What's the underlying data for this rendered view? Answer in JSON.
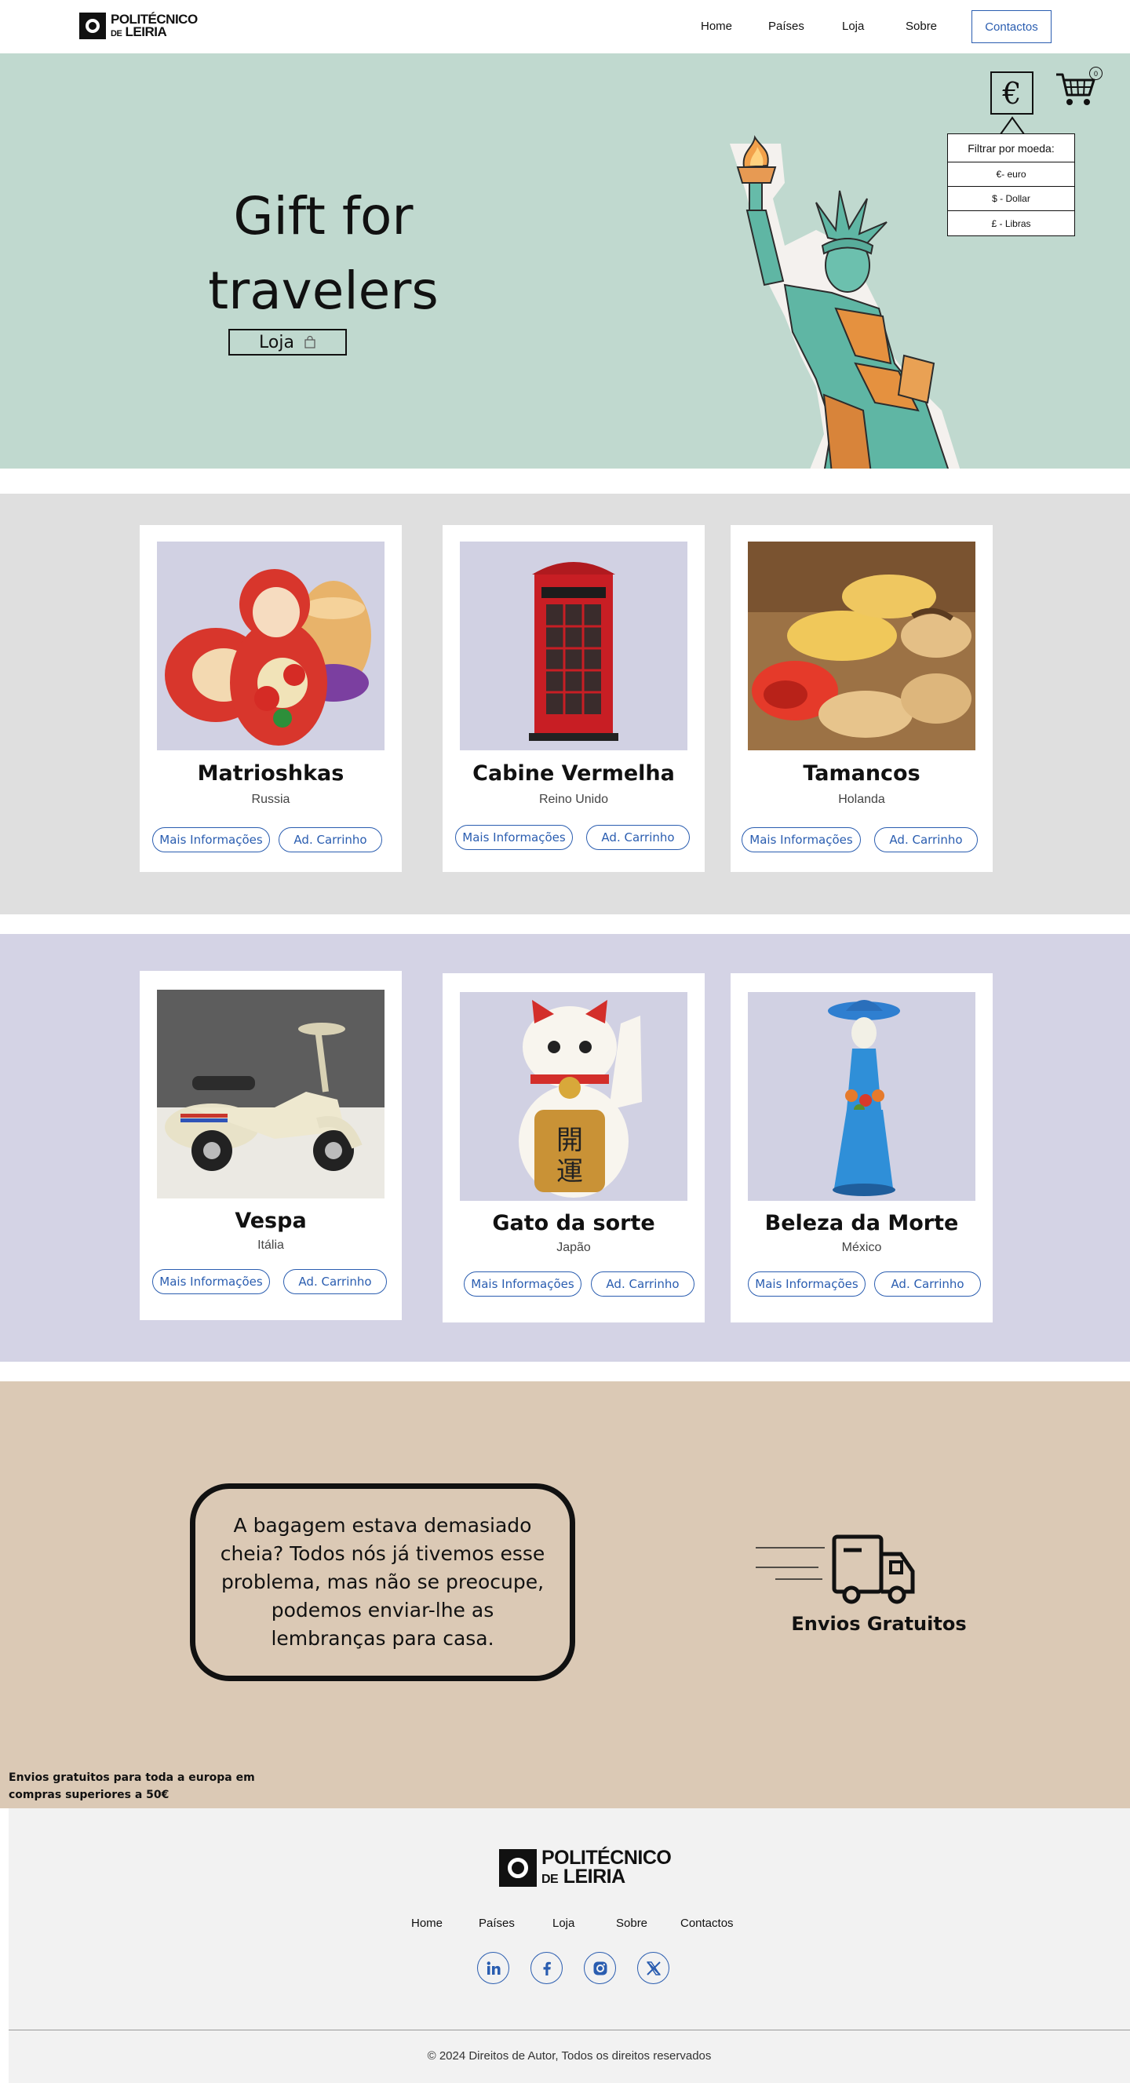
{
  "header": {
    "logo": {
      "line1": "POLITÉCNICO",
      "line2_small": "DE",
      "line2": "LEIRIA"
    },
    "nav": [
      "Home",
      "Países",
      "Loja",
      "Sobre"
    ],
    "contact_label": "Contactos"
  },
  "hero": {
    "title_line1": "Gift for",
    "title_line2": "travelers",
    "button_label": "Loja",
    "currency_symbol": "€",
    "cart_count": "0",
    "filter": {
      "title": "Filtrar por moeda:",
      "options": [
        "€- euro",
        "$ - Dollar",
        "£ - Libras"
      ]
    },
    "background_color": "#c0d9cf"
  },
  "products_row1": [
    {
      "name": "Matrioshkas",
      "country": "Russia",
      "info_label": "Mais Informações",
      "cart_label": "Ad. Carrinho"
    },
    {
      "name": "Cabine Vermelha",
      "country": "Reino Unido",
      "info_label": "Mais Informações",
      "cart_label": "Ad. Carrinho"
    },
    {
      "name": "Tamancos",
      "country": "Holanda",
      "info_label": "Mais Informações",
      "cart_label": "Ad. Carrinho"
    }
  ],
  "products_row2": [
    {
      "name": "Vespa",
      "country": "Itália",
      "info_label": "Mais Informações",
      "cart_label": "Ad. Carrinho"
    },
    {
      "name": "Gato da sorte",
      "country": "Japão",
      "info_label": "Mais Informações",
      "cart_label": "Ad. Carrinho"
    },
    {
      "name": "Beleza da Morte",
      "country": "México",
      "info_label": "Mais Informações",
      "cart_label": "Ad. Carrinho"
    }
  ],
  "shipping": {
    "bubble_text": "A bagagem estava demasiado cheia? Todos nós já tivemos esse problema, mas não se preocupe, podemos enviar-lhe as lembranças para casa.",
    "label": "Envios Gratuitos",
    "note": "Envios gratuitos para toda a europa em compras superiores a 50€"
  },
  "footer": {
    "logo": {
      "line1": "POLITÉCNICO",
      "line2_small": "DE",
      "line2": "LEIRIA"
    },
    "nav": [
      "Home",
      "Países",
      "Loja",
      "Sobre",
      "Contactos"
    ],
    "social": [
      "linkedin-icon",
      "facebook-icon",
      "instagram-icon",
      "x-icon"
    ],
    "copyright": "© 2024 Direitos de Autor, Todos os direitos reservados"
  },
  "colors": {
    "accent": "#2a5db0",
    "band1": "#dfdfdf",
    "band2": "#d4d3e5",
    "shipping": "#dbc9b5",
    "footer": "#f2f2f2"
  }
}
